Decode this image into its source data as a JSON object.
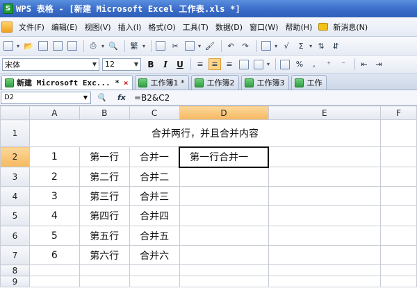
{
  "titlebar": {
    "logo": "S",
    "title": "WPS 表格 - [新建 Microsoft Excel 工作表.xls *]"
  },
  "menu": {
    "items": [
      "文件(F)",
      "编辑(E)",
      "视图(V)",
      "插入(I)",
      "格式(O)",
      "工具(T)",
      "数据(D)",
      "窗口(W)",
      "帮助(H)",
      "新消息(N)"
    ]
  },
  "format_toolbar": {
    "font_name": "宋体",
    "font_size": "12",
    "bold": "B",
    "italic": "I",
    "underline": "U"
  },
  "tabs": [
    {
      "label": "新建 Microsoft Exc... *",
      "close": "×"
    },
    {
      "label": "工作簿1 *"
    },
    {
      "label": "工作簿2"
    },
    {
      "label": "工作簿3"
    },
    {
      "label": "工作"
    }
  ],
  "formula_bar": {
    "cell_ref": "D2",
    "formula": "=B2&C2"
  },
  "sheet": {
    "columns": [
      "A",
      "B",
      "C",
      "D",
      "E",
      "F"
    ],
    "rows": [
      {
        "n": "1",
        "merged": "合并两行，并且合并内容"
      },
      {
        "n": "2",
        "a": "1",
        "b": "第一行",
        "c": "合并一",
        "d": "第一行合并一"
      },
      {
        "n": "3",
        "a": "2",
        "b": "第二行",
        "c": "合并二",
        "d": ""
      },
      {
        "n": "4",
        "a": "3",
        "b": "第三行",
        "c": "合并三",
        "d": ""
      },
      {
        "n": "5",
        "a": "4",
        "b": "第四行",
        "c": "合并四",
        "d": ""
      },
      {
        "n": "6",
        "a": "5",
        "b": "第五行",
        "c": "合并五",
        "d": ""
      },
      {
        "n": "7",
        "a": "6",
        "b": "第六行",
        "c": "合并六",
        "d": ""
      },
      {
        "n": "8"
      },
      {
        "n": "9"
      }
    ],
    "active_cell": "D2"
  },
  "colors": {
    "title_bar": "#3a6cc8",
    "selection_header": "#f6b860",
    "grid_line": "#c7ccd6"
  }
}
